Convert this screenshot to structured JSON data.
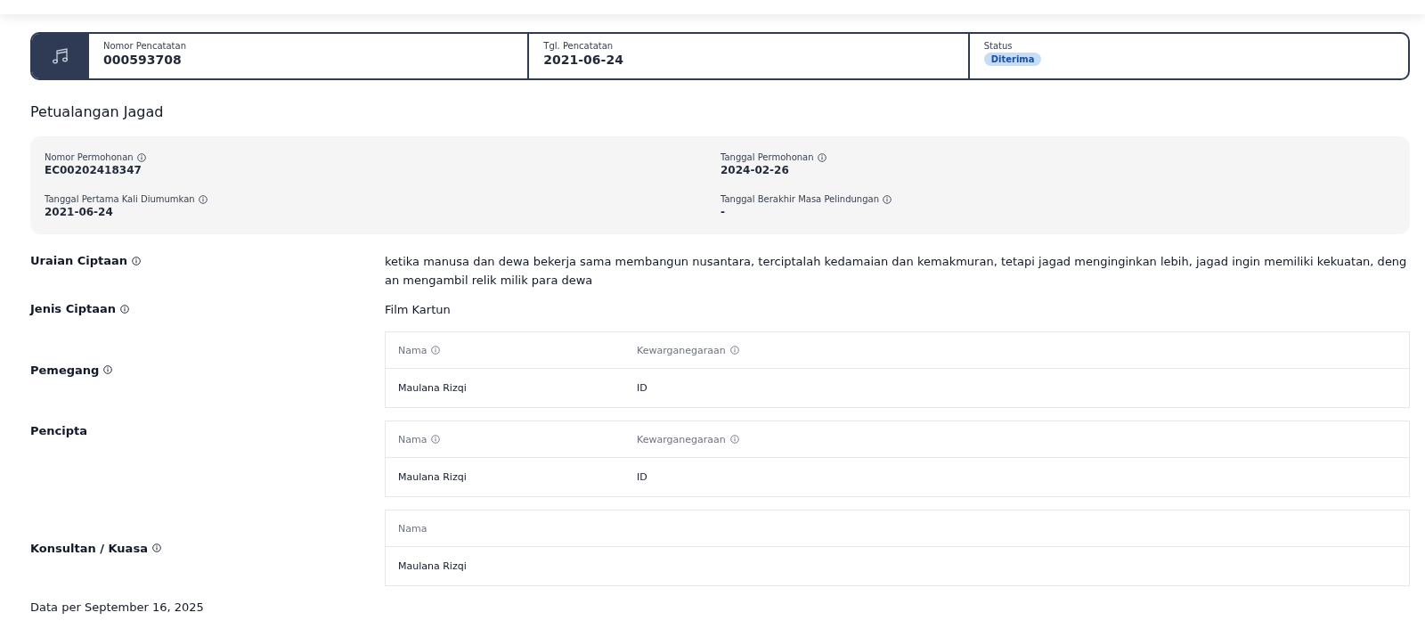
{
  "summary": {
    "fields": [
      {
        "label": "Nomor Pencatatan",
        "value": "000593708",
        "kind": "text"
      },
      {
        "label": "Tgl. Pencatatan",
        "value": "2021-06-24",
        "kind": "text"
      },
      {
        "label": "Status",
        "value": "Diterima",
        "kind": "badge"
      }
    ]
  },
  "title": "Petualangan Jagad",
  "details": [
    {
      "label": "Nomor Permohonan",
      "info": true,
      "value": "EC00202418347"
    },
    {
      "label": "Tanggal Permohonan",
      "info": true,
      "value": "2024-02-26"
    },
    {
      "label": "Tanggal Pertama Kali Diumumkan",
      "info": true,
      "value": "2021-06-24"
    },
    {
      "label": "Tanggal Berakhir Masa Pelindungan",
      "info": true,
      "value": "-"
    }
  ],
  "sections": [
    {
      "label": "Uraian Ciptaan",
      "info": true,
      "kind": "text",
      "value": "ketika manusa dan dewa bekerja sama membangun nusantara, terciptalah kedamaian dan kemakmuran, tetapi jagad menginginkan lebih, jagad ingin memiliki kekuatan, dengan mengambil relik milik para dewa"
    },
    {
      "label": "Jenis Ciptaan",
      "info": true,
      "kind": "text",
      "value": "Film Kartun"
    },
    {
      "label": "Pemegang",
      "info": true,
      "kind": "table",
      "columns": [
        {
          "label": "Nama",
          "info": true
        },
        {
          "label": "Kewarganegaraan",
          "info": true
        }
      ],
      "rows": [
        [
          "Maulana Rizqi",
          "ID"
        ]
      ]
    },
    {
      "label": "Pencipta",
      "info": false,
      "kind": "table",
      "columns": [
        {
          "label": "Nama",
          "info": true
        },
        {
          "label": "Kewarganegaraan",
          "info": true
        }
      ],
      "rows": [
        [
          "Maulana Rizqi",
          "ID"
        ]
      ]
    },
    {
      "label": "Konsultan / Kuasa",
      "info": true,
      "kind": "table",
      "columns": [
        {
          "label": "Nama",
          "info": false
        }
      ],
      "rows": [
        [
          "Maulana Rizqi"
        ]
      ]
    }
  ],
  "footer": "Data per September 16, 2025"
}
